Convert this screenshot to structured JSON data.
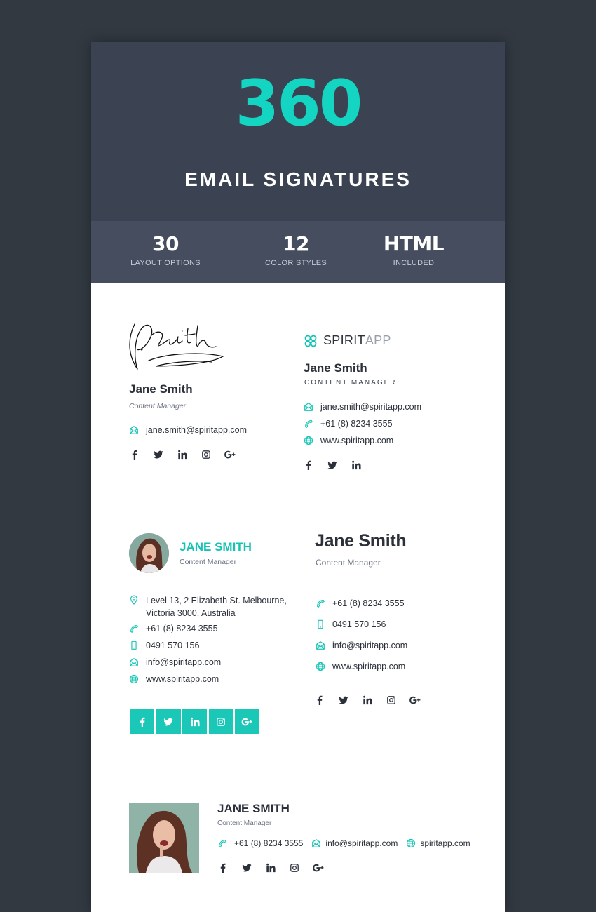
{
  "hero": {
    "count": "360",
    "title": "EMAIL SIGNATURES"
  },
  "stats": [
    {
      "value": "30",
      "label": "LAYOUT OPTIONS"
    },
    {
      "value": "12",
      "label": "COLOR STYLES"
    },
    {
      "value": "HTML",
      "label": "INCLUDED"
    }
  ],
  "colors": {
    "accent": "#14d4c2",
    "hero_bg": "#3b4352",
    "stats_bg": "#454d5f",
    "page_bg": "#323941",
    "text_dark": "#2b303a"
  },
  "sig1": {
    "signature": "J. Smith",
    "name": "Jane Smith",
    "role": "Content Manager",
    "email": "jane.smith@spiritapp.com",
    "social": [
      "facebook",
      "twitter",
      "linkedin",
      "instagram",
      "google-plus"
    ]
  },
  "sig2": {
    "logo_bold": "SPIRIT",
    "logo_light": "APP",
    "name": "Jane Smith",
    "role": "CONTENT MANAGER",
    "email": "jane.smith@spiritapp.com",
    "phone": "+61 (8) 8234 3555",
    "web": "www.spiritapp.com",
    "social": [
      "facebook",
      "twitter",
      "linkedin"
    ]
  },
  "sig3": {
    "name": "JANE SMITH",
    "role": "Content Manager",
    "address_line1": "Level 13, 2 Elizabeth St. Melbourne,",
    "address_line2": "Victoria 3000, Australia",
    "phone": "+61 (8) 8234 3555",
    "mobile": "0491 570 156",
    "email": "info@spiritapp.com",
    "web": "www.spiritapp.com",
    "social": [
      "facebook",
      "twitter",
      "linkedin",
      "instagram",
      "google-plus"
    ]
  },
  "sig4": {
    "name": "Jane Smith",
    "role": "Content Manager",
    "phone": "+61 (8) 8234 3555",
    "mobile": "0491 570 156",
    "email": "info@spiritapp.com",
    "web": "www.spiritapp.com",
    "social": [
      "facebook",
      "twitter",
      "linkedin",
      "instagram",
      "google-plus"
    ]
  },
  "sig5": {
    "name": "JANE SMITH",
    "role": "Content Manager",
    "phone": "+61 (8) 8234 3555",
    "email": "info@spiritapp.com",
    "web": "spiritapp.com",
    "social": [
      "facebook",
      "twitter",
      "linkedin",
      "instagram",
      "google-plus"
    ]
  },
  "icons": {
    "gplus": "G+",
    "linkedin": "in"
  }
}
